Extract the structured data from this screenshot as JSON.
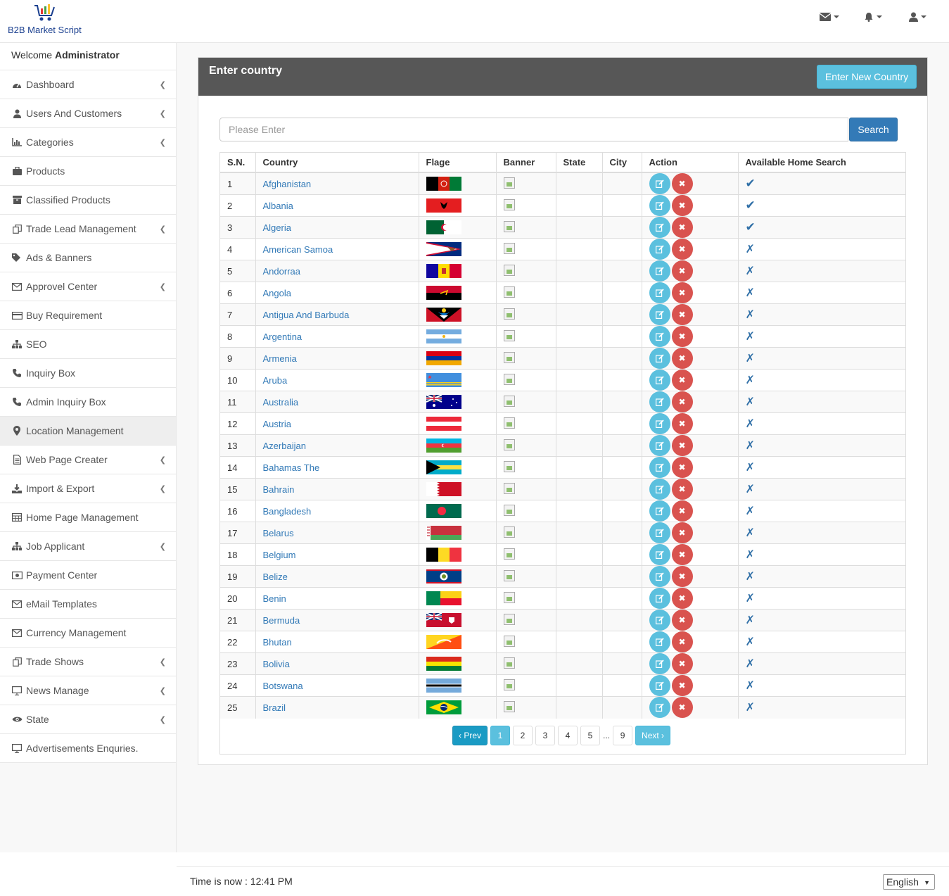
{
  "app": {
    "logo_text": "B2B Market Script"
  },
  "topbar": {
    "icons": [
      "envelope-icon",
      "bell-icon",
      "user-icon"
    ]
  },
  "sidebar": {
    "welcome_prefix": "Welcome",
    "welcome_user": "Administrator",
    "items": [
      {
        "label": "Dashboard",
        "icon": "dashboard-icon",
        "submenu": true
      },
      {
        "label": "Users And Customers",
        "icon": "user-icon",
        "submenu": true
      },
      {
        "label": "Categories",
        "icon": "bar-chart-icon",
        "submenu": true
      },
      {
        "label": "Products",
        "icon": "briefcase-icon",
        "submenu": false
      },
      {
        "label": "Classified Products",
        "icon": "archive-icon",
        "submenu": false
      },
      {
        "label": "Trade Lead Management",
        "icon": "copy-icon",
        "submenu": true
      },
      {
        "label": "Ads & Banners",
        "icon": "tags-icon",
        "submenu": false
      },
      {
        "label": "Approvel Center",
        "icon": "envelope-icon",
        "submenu": true
      },
      {
        "label": "Buy Requirement",
        "icon": "credit-card-icon",
        "submenu": false
      },
      {
        "label": "SEO",
        "icon": "sitemap-icon",
        "submenu": false
      },
      {
        "label": "Inquiry Box",
        "icon": "phone-icon",
        "submenu": false
      },
      {
        "label": "Admin Inquiry Box",
        "icon": "phone-icon",
        "submenu": false
      },
      {
        "label": "Location Management",
        "icon": "map-marker-icon",
        "submenu": false
      },
      {
        "label": "Web Page Creater",
        "icon": "file-icon",
        "submenu": true
      },
      {
        "label": "Import & Export",
        "icon": "download-icon",
        "submenu": true
      },
      {
        "label": "Home Page Management",
        "icon": "table-icon",
        "submenu": false
      },
      {
        "label": "Job Applicant",
        "icon": "sitemap-icon",
        "submenu": true
      },
      {
        "label": "Payment Center",
        "icon": "money-icon",
        "submenu": false
      },
      {
        "label": "eMail Templates",
        "icon": "envelope-icon",
        "submenu": false
      },
      {
        "label": "Currency Management",
        "icon": "envelope-icon",
        "submenu": false
      },
      {
        "label": "Trade Shows",
        "icon": "copy-icon",
        "submenu": true
      },
      {
        "label": "News Manage",
        "icon": "desktop-icon",
        "submenu": true
      },
      {
        "label": "State",
        "icon": "eye-icon",
        "submenu": true
      },
      {
        "label": "Advertisements Enquries.",
        "icon": "desktop-icon",
        "submenu": false
      }
    ],
    "active_index": 12
  },
  "panel": {
    "title": "Enter country",
    "new_button": "Enter New Country",
    "search_placeholder": "Please Enter",
    "search_button": "Search"
  },
  "table": {
    "headers": [
      "S.N.",
      "Country",
      "Flage",
      "Banner",
      "State",
      "City",
      "Action",
      "Available Home Search"
    ],
    "rows": [
      {
        "sn": "1",
        "country": "Afghanistan",
        "home": true
      },
      {
        "sn": "2",
        "country": "Albania",
        "home": true
      },
      {
        "sn": "3",
        "country": "Algeria",
        "home": true
      },
      {
        "sn": "4",
        "country": "American Samoa",
        "home": false
      },
      {
        "sn": "5",
        "country": "Andorraa",
        "home": false
      },
      {
        "sn": "6",
        "country": "Angola",
        "home": false
      },
      {
        "sn": "7",
        "country": "Antigua And Barbuda",
        "home": false
      },
      {
        "sn": "8",
        "country": "Argentina",
        "home": false
      },
      {
        "sn": "9",
        "country": "Armenia",
        "home": false
      },
      {
        "sn": "10",
        "country": "Aruba",
        "home": false
      },
      {
        "sn": "11",
        "country": "Australia",
        "home": false
      },
      {
        "sn": "12",
        "country": "Austria",
        "home": false
      },
      {
        "sn": "13",
        "country": "Azerbaijan",
        "home": false
      },
      {
        "sn": "14",
        "country": "Bahamas The",
        "home": false
      },
      {
        "sn": "15",
        "country": "Bahrain",
        "home": false
      },
      {
        "sn": "16",
        "country": "Bangladesh",
        "home": false
      },
      {
        "sn": "17",
        "country": "Belarus",
        "home": false
      },
      {
        "sn": "18",
        "country": "Belgium",
        "home": false
      },
      {
        "sn": "19",
        "country": "Belize",
        "home": false
      },
      {
        "sn": "20",
        "country": "Benin",
        "home": false
      },
      {
        "sn": "21",
        "country": "Bermuda",
        "home": false
      },
      {
        "sn": "22",
        "country": "Bhutan",
        "home": false
      },
      {
        "sn": "23",
        "country": "Bolivia",
        "home": false
      },
      {
        "sn": "24",
        "country": "Botswana",
        "home": false
      },
      {
        "sn": "25",
        "country": "Brazil",
        "home": false
      }
    ]
  },
  "pagination": {
    "prev": "‹ Prev",
    "next": "Next ›",
    "pages": [
      "1",
      "2",
      "3",
      "4",
      "5",
      "...",
      "9"
    ],
    "current": "1"
  },
  "footer": {
    "time_text": "Time is now : 12:41 PM",
    "language": "English"
  },
  "colors": {
    "accent": "#5bc0de",
    "primary": "#337ab7",
    "danger": "#d9534f",
    "panel_header": "#575757"
  }
}
